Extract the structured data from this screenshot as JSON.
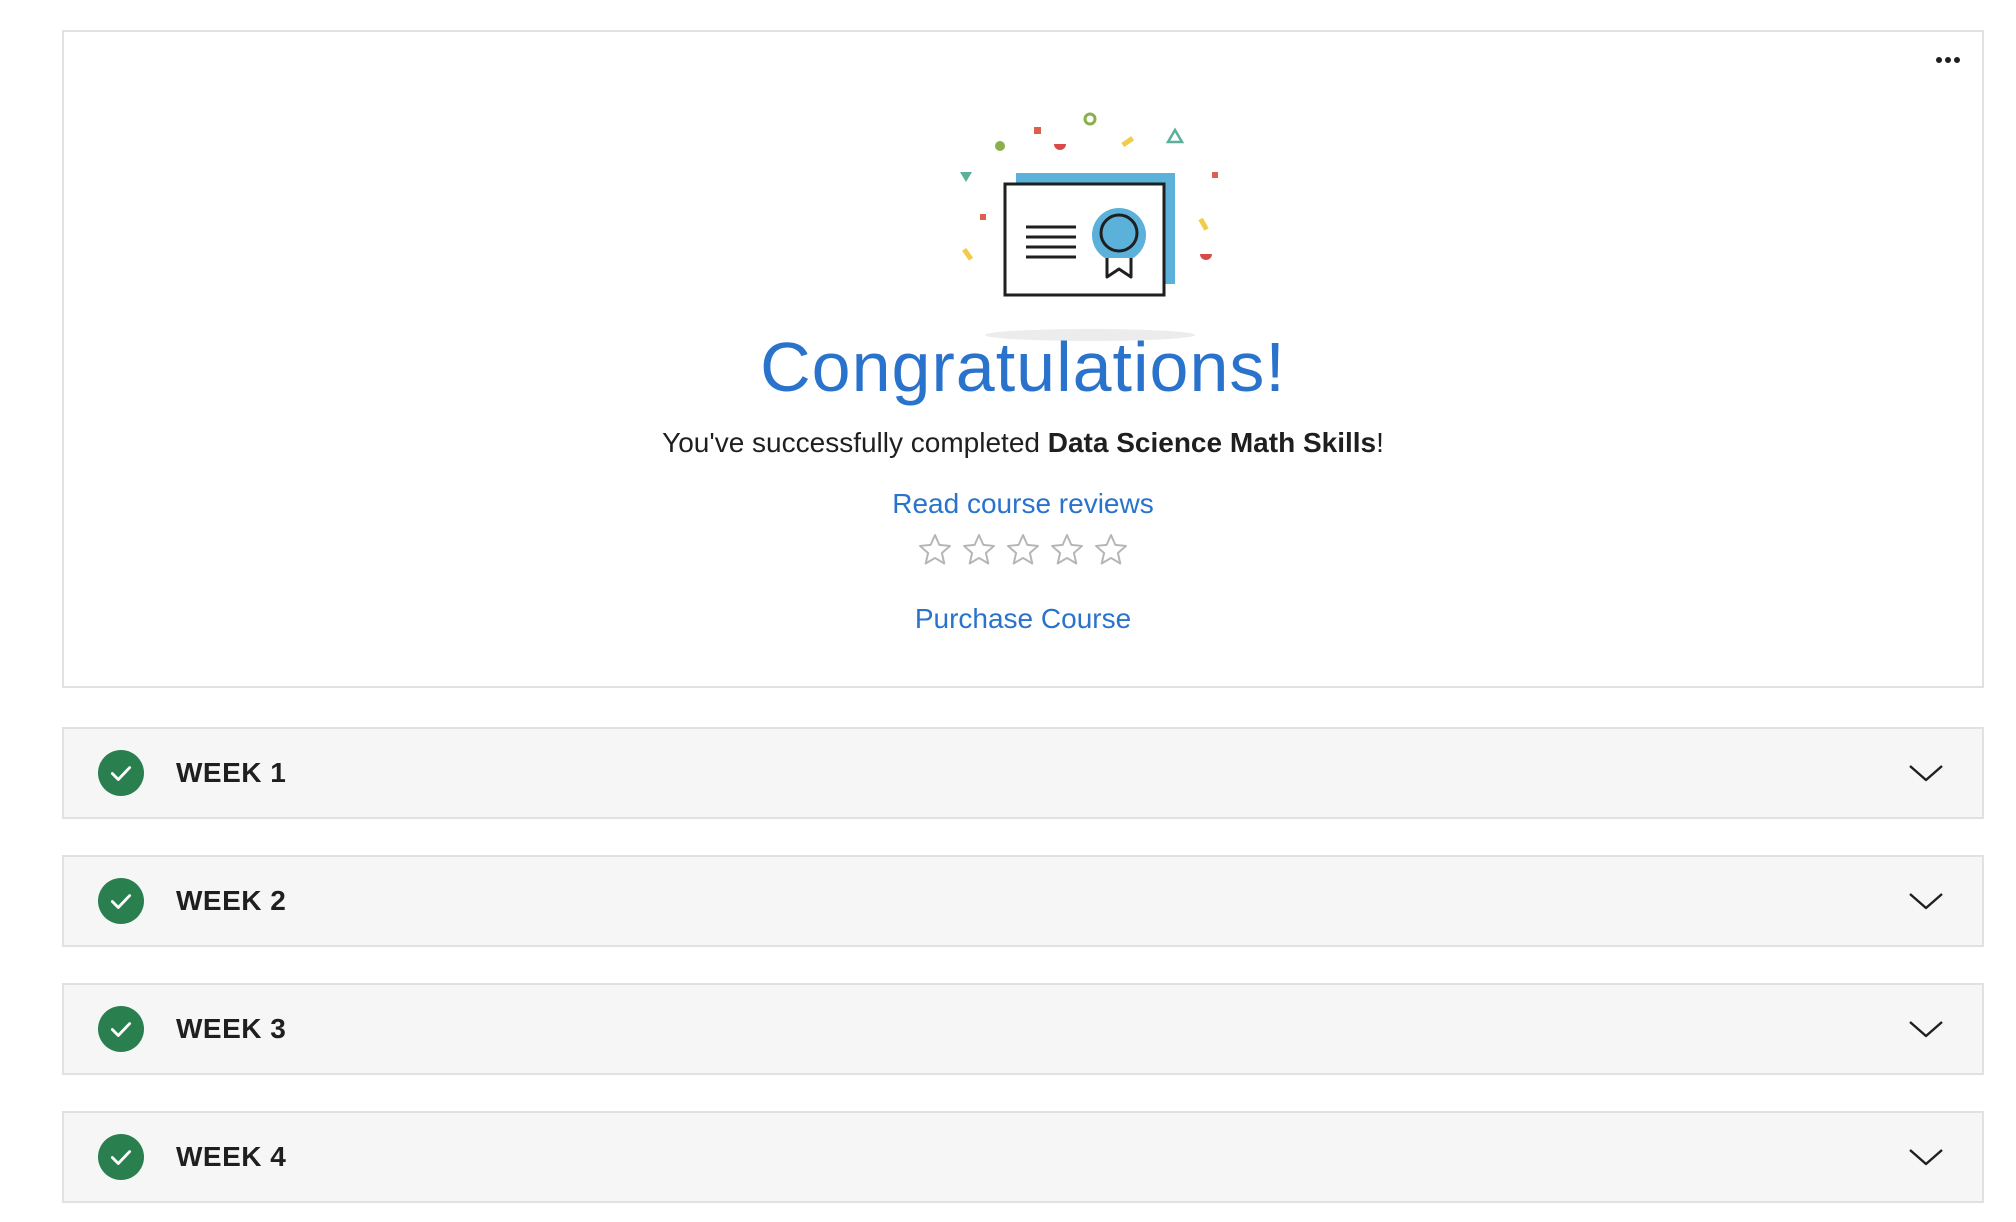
{
  "completion": {
    "title": "Congratulations!",
    "message_prefix": "You've successfully completed ",
    "course_name": "Data Science Math Skills",
    "message_suffix": "!",
    "reviews_link": "Read course reviews",
    "rating": {
      "max": 5,
      "value": 0
    },
    "purchase_link": "Purchase Course"
  },
  "menu": {
    "icon": "more-horizontal-icon"
  },
  "weeks": [
    {
      "label": "WEEK 1",
      "completed": true
    },
    {
      "label": "WEEK 2",
      "completed": true
    },
    {
      "label": "WEEK 3",
      "completed": true
    },
    {
      "label": "WEEK 4",
      "completed": true
    }
  ],
  "colors": {
    "accent": "#2a73cc",
    "success": "#2a7f4f",
    "row_bg": "#f6f6f6",
    "border": "#e1e1e1",
    "cert_blue": "#5bb1da"
  }
}
